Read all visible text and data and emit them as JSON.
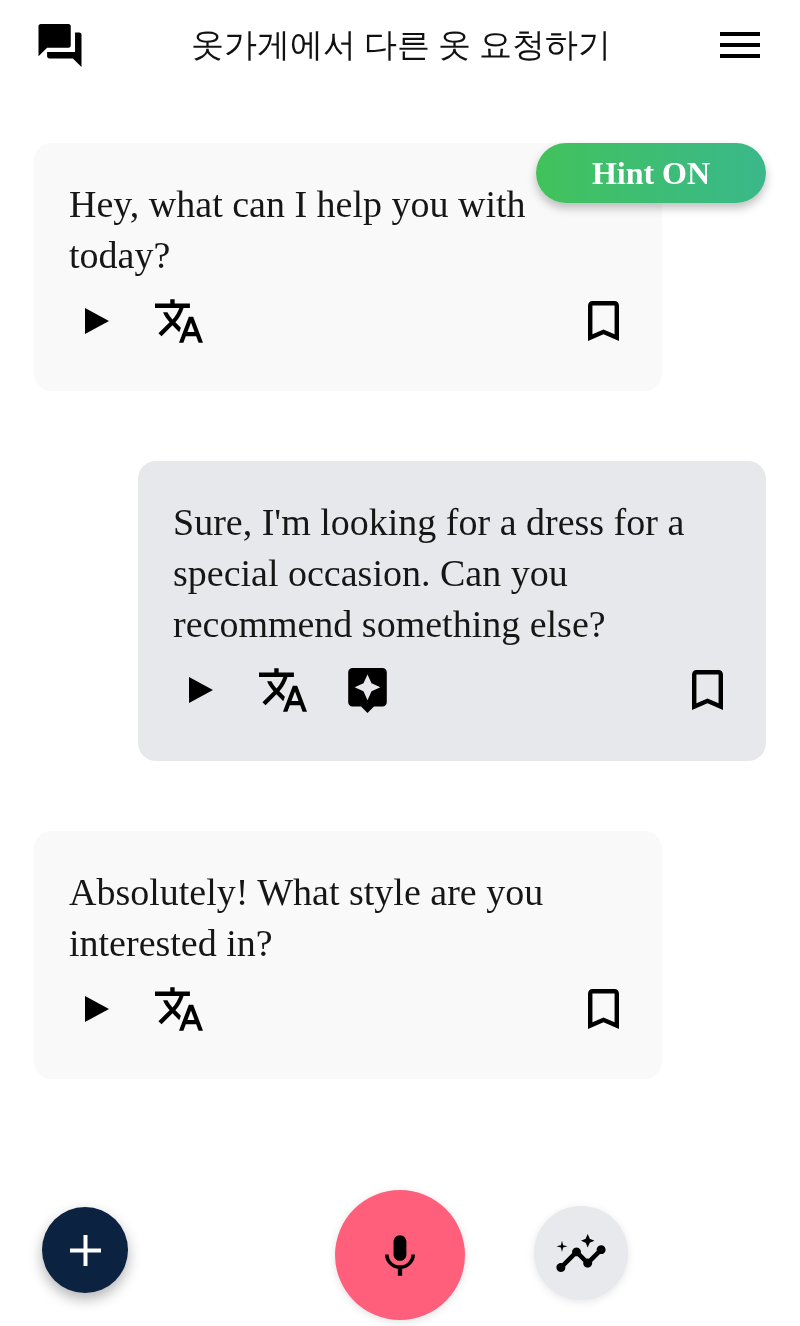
{
  "header": {
    "title": "옷가게에서 다른 옷 요청하기"
  },
  "hint": {
    "label": "Hint ON",
    "on": true
  },
  "messages": [
    {
      "kind": "bot",
      "text": "Hey, what can I help you with today?",
      "bookmarked": false
    },
    {
      "kind": "user",
      "text": "Sure, I'm looking for a dress for a special occasion. Can you recommend something else?",
      "bookmarked": false
    },
    {
      "kind": "bot",
      "text": "Absolutely! What style are you interested in?",
      "bookmarked": false
    }
  ]
}
